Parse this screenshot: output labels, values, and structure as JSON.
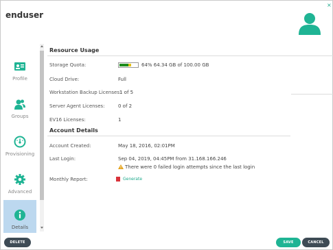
{
  "dialog": {
    "title": "enduser",
    "close_glyph": "×"
  },
  "colors": {
    "accent": "#1fb494",
    "nav_active_bg": "#bcd8ef",
    "dark_button": "#3e4b55",
    "warning": "#e4a21a",
    "generate_red": "#d9323a"
  },
  "sidebar": {
    "items": [
      {
        "label": "Profile",
        "icon": "id-card-icon"
      },
      {
        "label": "Groups",
        "icon": "users-icon"
      },
      {
        "label": "Provisioning",
        "icon": "dashboard-icon"
      },
      {
        "label": "Advanced",
        "icon": "gear-icon"
      },
      {
        "label": "Details",
        "icon": "info-icon",
        "active": true
      }
    ]
  },
  "resource_usage": {
    "title": "Resource Usage",
    "storage_quota": {
      "label": "Storage Quota:",
      "percent": 64,
      "value": "64% 64.34 GB of 100.00 GB"
    },
    "cloud_drive": {
      "label": "Cloud Drive:",
      "value": "Full"
    },
    "workstation_backup": {
      "label": "Workstation Backup Licenses:",
      "value": "1 of 5"
    },
    "server_agent": {
      "label": "Server Agent Licenses:",
      "value": "0 of 2"
    },
    "ev16": {
      "label": "EV16 Licenses:",
      "value": "1"
    }
  },
  "account_details": {
    "title": "Account Details",
    "created": {
      "label": "Account Created:",
      "value": "May 18, 2016, 02:01PM"
    },
    "last_login": {
      "label": "Last Login:",
      "value": "Sep 04, 2019, 04:45PM from 31.168.166.246",
      "warning": "There were 0 failed login attempts since the last login"
    },
    "monthly_report": {
      "label": "Monthly Report:",
      "link": "Generate"
    }
  },
  "footer": {
    "delete_label": "DELETE",
    "save_label": "SAVE",
    "cancel_label": "CANCEL"
  }
}
